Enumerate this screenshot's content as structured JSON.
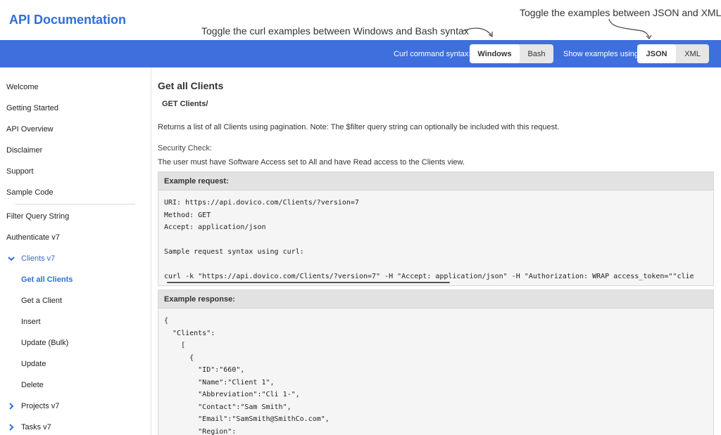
{
  "header": {
    "title": "API Documentation",
    "note_curl": "Toggle the curl examples between Windows and Bash syntax",
    "note_format": "Toggle the examples between JSON and XML"
  },
  "toolbar": {
    "curl_label": "Curl command syntax:",
    "curl_options": [
      "Windows",
      "Bash"
    ],
    "curl_selected": "Windows",
    "format_label": "Show examples using:",
    "format_options": [
      "JSON",
      "XML"
    ],
    "format_selected": "JSON"
  },
  "sidebar": {
    "items": [
      {
        "label": "Welcome"
      },
      {
        "label": "Getting Started"
      },
      {
        "label": "API Overview"
      },
      {
        "label": "Disclaimer"
      },
      {
        "label": "Support"
      },
      {
        "label": "Sample Code"
      },
      {
        "label": "Filter Query String"
      },
      {
        "label": "Authenticate v7"
      },
      {
        "label": "Clients v7"
      },
      {
        "label": "Get all Clients"
      },
      {
        "label": "Get a Client"
      },
      {
        "label": "Insert"
      },
      {
        "label": "Update (Bulk)"
      },
      {
        "label": "Update"
      },
      {
        "label": "Delete"
      },
      {
        "label": "Projects v7"
      },
      {
        "label": "Tasks v7"
      }
    ]
  },
  "main": {
    "title": "Get all Clients",
    "endpoint": "GET Clients/",
    "description": "Returns a list of all Clients using pagination. Note: The $filter query string can optionally be included with this request.",
    "security_title": "Security Check:",
    "security_text": "The user must have Software Access set to All and have Read access to the Clients view.",
    "request_title": "Example request:",
    "request_code": "URI: https://api.dovico.com/Clients/?version=7\nMethod: GET\nAccept: application/json\n\nSample request syntax using curl:\n\ncurl -k \"https://api.dovico.com/Clients/?version=7\" -H \"Accept: application/json\" -H \"Authorization: WRAP access_token=\"\"clie",
    "response_title": "Example response:",
    "response_code": "{\n  \"Clients\":\n    [\n      {\n        \"ID\":\"660\",\n        \"Name\":\"Client 1\",\n        \"Abbreviation\":\"Cli 1-\",\n        \"Contact\":\"Sam Smith\",\n        \"Email\":\"SamSmith@SmithCo.com\",\n        \"Region\":"
  },
  "colors": {
    "accent": "#3f6fdc",
    "brand": "#2f6fd6"
  }
}
